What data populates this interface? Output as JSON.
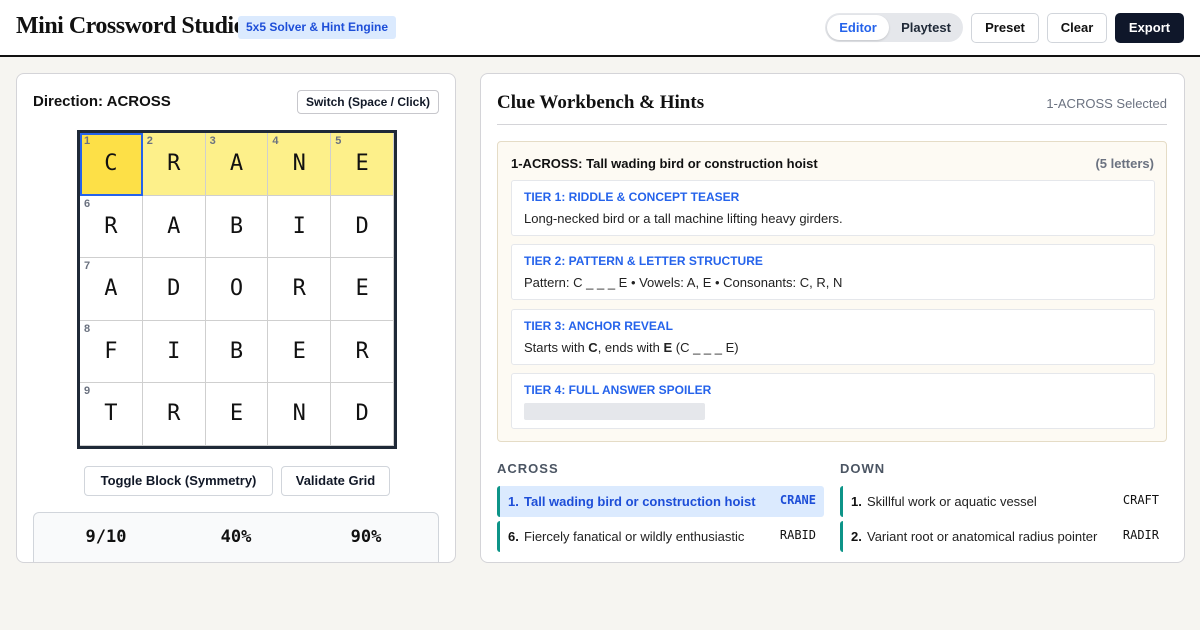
{
  "header": {
    "title": "Mini Crossword Studio",
    "badge": "5x5 Solver & Hint Engine",
    "modes": [
      "Editor",
      "Playtest"
    ],
    "active_mode": "Editor",
    "buttons": {
      "preset": "Preset",
      "clear": "Clear",
      "export": "Export"
    }
  },
  "editor": {
    "direction_label": "Direction: ACROSS",
    "switch_label": "Switch (Space / Click)",
    "grid": {
      "letters": [
        [
          "C",
          "R",
          "A",
          "N",
          "E"
        ],
        [
          "R",
          "A",
          "B",
          "I",
          "D"
        ],
        [
          "A",
          "D",
          "O",
          "R",
          "E"
        ],
        [
          "F",
          "I",
          "B",
          "E",
          "R"
        ],
        [
          "T",
          "R",
          "E",
          "N",
          "D"
        ]
      ],
      "numbers": [
        [
          "1",
          "2",
          "3",
          "4",
          "5"
        ],
        [
          "6",
          "",
          "",
          "",
          ""
        ],
        [
          "7",
          "",
          "",
          "",
          ""
        ],
        [
          "8",
          "",
          "",
          "",
          ""
        ],
        [
          "9",
          "",
          "",
          "",
          ""
        ]
      ],
      "selected_cell": [
        0,
        0
      ],
      "highlighted_row": 0
    },
    "toggle_block_label": "Toggle Block (Symmetry)",
    "validate_label": "Validate Grid",
    "stats": [
      "9/10",
      "40%",
      "90%"
    ]
  },
  "workbench": {
    "title": "Clue Workbench & Hints",
    "selected_label": "1-ACROSS Selected",
    "clue_heading": "1-ACROSS: Tall wading bird or construction hoist",
    "clue_length": "(5 letters)",
    "tiers": [
      {
        "label": "TIER 1: RIDDLE & CONCEPT TEASER",
        "text": "Long-necked bird or a tall machine lifting heavy girders."
      },
      {
        "label": "TIER 2: PATTERN & LETTER STRUCTURE",
        "text": "Pattern: C _ _ _ E • Vowels: A, E • Consonants: C, R, N"
      },
      {
        "label": "TIER 3: ANCHOR REVEAL",
        "text_pre": "Starts with ",
        "text_b1": "C",
        "text_mid": ", ends with ",
        "text_b2": "E",
        "text_post": " (C _ _ _ E)"
      },
      {
        "label": "TIER 4: FULL ANSWER SPOILER",
        "text": ""
      }
    ]
  },
  "clues": {
    "across_heading": "ACROSS",
    "down_heading": "DOWN",
    "across": [
      {
        "num": "1.",
        "text": "Tall wading bird or construction hoist",
        "answer": "CRANE",
        "active": true
      },
      {
        "num": "6.",
        "text": "Fiercely fanatical or wildly enthusiastic",
        "answer": "RABID",
        "active": false
      }
    ],
    "down": [
      {
        "num": "1.",
        "text": "Skillful work or aquatic vessel",
        "answer": "CRAFT",
        "active": false
      },
      {
        "num": "2.",
        "text": "Variant root or anatomical radius pointer",
        "answer": "RADIR",
        "active": false
      }
    ]
  },
  "colors": {
    "accent": "#2563eb",
    "selected_cell": "#fde047",
    "highlight_cell": "#fdf08a",
    "clue_marker": "#0d9488",
    "export_button": "#0f172a"
  }
}
